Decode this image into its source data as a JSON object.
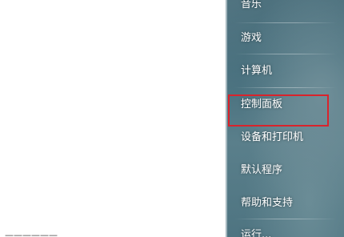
{
  "start_menu": {
    "left_pane": {
      "bottom_text": "——————"
    },
    "right_pane": {
      "items": [
        {
          "label": "音乐"
        },
        {
          "label": "游戏"
        },
        {
          "label": "计算机"
        },
        {
          "label": "控制面板"
        },
        {
          "label": "设备和打印机"
        },
        {
          "label": "默认程序"
        },
        {
          "label": "帮助和支持"
        },
        {
          "label": "运行..."
        }
      ]
    },
    "highlighted_item": "控制面板",
    "highlight_color": "#d9232b",
    "pane_colors": {
      "left": "#ffffff",
      "right": "#4e7481"
    }
  }
}
